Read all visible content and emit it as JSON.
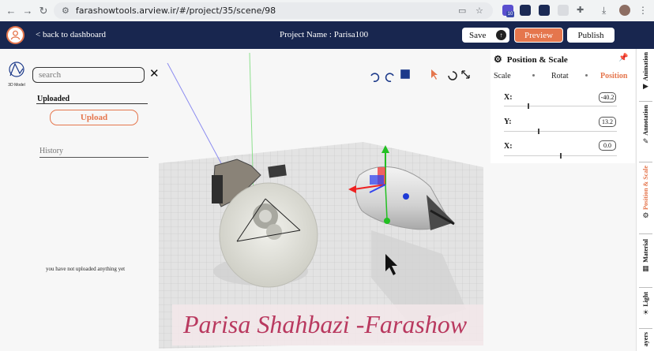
{
  "browser": {
    "url": "farashowtools.arview.ir/#/project/35/scene/98",
    "ext_badge": "10"
  },
  "header": {
    "back_label": "< back to dashboard",
    "project_name": "Project Name : Parisa100",
    "save_label": "Save",
    "preview_label": "Preview",
    "publish_label": "Publish"
  },
  "left_panel": {
    "tool_label": "3D Model",
    "search_placeholder": "search",
    "uploaded_heading": "Uploaded",
    "upload_button": "Upload",
    "history_heading": "History",
    "empty_message": "you have not uploaded anything yet"
  },
  "right_panel": {
    "title": "Position & Scale",
    "modes": [
      "Scale",
      "Rotat",
      "Position"
    ],
    "active_mode": "Position",
    "axes": [
      {
        "label": "X:",
        "value": "-40.2",
        "slider_fraction": 0.22
      },
      {
        "label": "Y:",
        "value": "13.2",
        "slider_fraction": 0.31
      },
      {
        "label": "X:",
        "value": "0.0",
        "slider_fraction": 0.5
      }
    ]
  },
  "side_tabs": [
    "Animation",
    "Annotation",
    "Position & Scale",
    "Material",
    "Light",
    "ayers"
  ],
  "active_side_tab": "Position & Scale",
  "watermark": "Parisa Shahbazi -Farashow",
  "colors": {
    "header_bg": "#18264f",
    "accent": "#e5764d",
    "panel_bg": "#f7f7f7"
  },
  "icons": [
    "user-avatar-icon",
    "undo-icon",
    "redo-icon",
    "save-disk-icon",
    "cursor-icon",
    "rotate-icon",
    "resize-icon",
    "gear-icon",
    "pin-icon",
    "close-icon"
  ]
}
